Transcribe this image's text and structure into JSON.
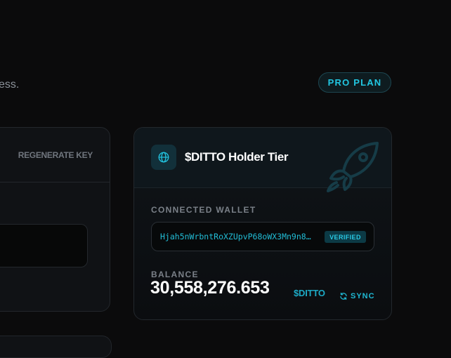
{
  "header": {
    "subtitle_fragment": "ess.",
    "plan_badge": "PRO PLAN"
  },
  "api_key_card": {
    "regenerate_label": "REGENERATE KEY"
  },
  "tier_card": {
    "title": "$DITTO Holder Tier",
    "connected_wallet_label": "CONNECTED WALLET",
    "wallet_address": "Hjah5nWrbntRoXZUpvP68oWX3Mn9n8…",
    "verified_label": "VERIFIED",
    "balance_label": "BALANCE",
    "balance_value": "30,558,276.653",
    "balance_unit": "$DITTO",
    "sync_label": "SYNC"
  },
  "icons": [
    "globe-icon",
    "rocket-icon",
    "sync-icon"
  ],
  "colors": {
    "background": "#0b0b0c",
    "accent": "#22c7e2",
    "card": "#101215"
  }
}
